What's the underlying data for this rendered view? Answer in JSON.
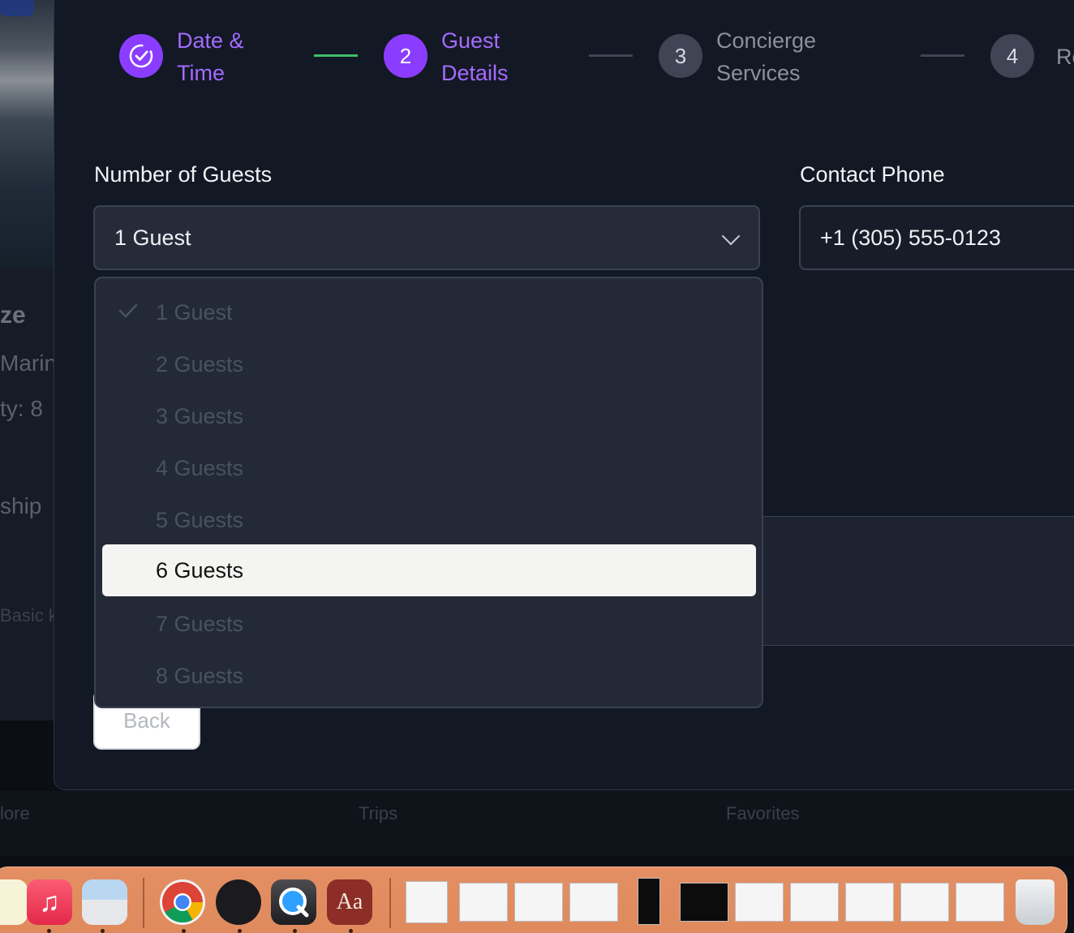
{
  "background": {
    "left_texts": [
      "ze",
      "Marin",
      "ty: 8",
      "ship",
      "Basic k",
      "lore"
    ],
    "tabs": [
      "Trips",
      "Favorites"
    ],
    "hidden_button": "Back"
  },
  "stepper": {
    "steps": [
      {
        "number": "",
        "label": "Date &\nTime",
        "state": "complete"
      },
      {
        "number": "2",
        "label": "Guest\nDetails",
        "state": "active"
      },
      {
        "number": "3",
        "label": "Concierge\nServices",
        "state": "pending"
      },
      {
        "number": "4",
        "label": "Re",
        "state": "pending"
      }
    ]
  },
  "form": {
    "guests_label": "Number of Guests",
    "guests_value": "1 Guest",
    "phone_label": "Contact Phone",
    "phone_value": "+1 (305) 555-0123"
  },
  "dropdown": {
    "options": [
      "1 Guest",
      "2 Guests",
      "3 Guests",
      "4 Guests",
      "5 Guests",
      "6 Guests",
      "7 Guests",
      "8 Guests"
    ],
    "selected": "1 Guest",
    "highlighted": "6 Guests"
  },
  "dock": {
    "apps": [
      "notes-icon",
      "music-icon",
      "preview-icon",
      "chrome-icon",
      "instruments-icon",
      "quicktime-icon",
      "dictionary-icon"
    ],
    "dictionary_glyph": "Aa"
  },
  "colors": {
    "accent": "#8b3dff",
    "success": "#3fbf6a",
    "modal_bg": "#131825"
  }
}
